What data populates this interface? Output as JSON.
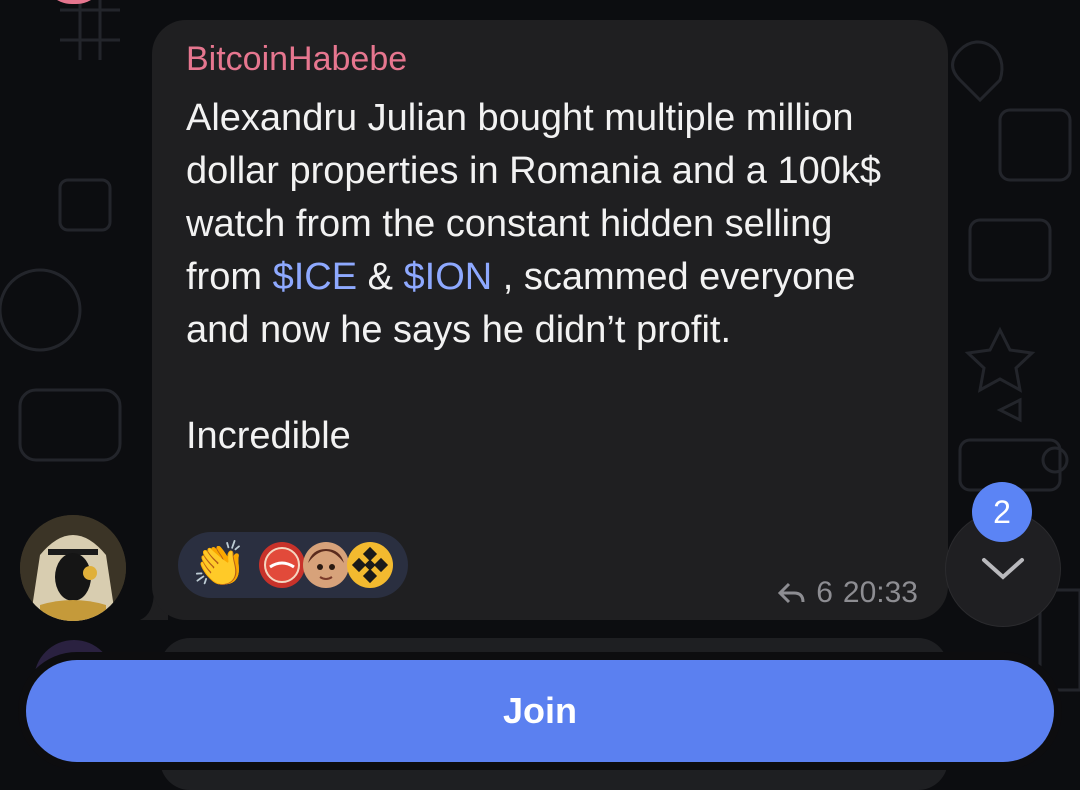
{
  "message": {
    "sender": "BitcoinHabebe",
    "text_before_ice": "Alexandru Julian bought multiple million dollar properties in Romania and a 100k$ watch from the constant hidden selling from ",
    "mention_ice": "$ICE",
    "text_between": " & ",
    "mention_ion": "$ION",
    "text_after_ion": " , scammed everyone and now he says he didn’t profit.",
    "text_final": "Incredible",
    "reactions": [
      {
        "emoji": "clapping-hands",
        "glyph": "👏"
      },
      {
        "emoji": "dude-bottle-cap"
      },
      {
        "emoji": "cartoon-avatar"
      },
      {
        "emoji": "binance-logo"
      }
    ],
    "forward_count": "6",
    "time": "20:33"
  },
  "scroll_down": {
    "unread_count": "2"
  },
  "join_button": {
    "label": "Join"
  },
  "colors": {
    "sender_name": "#e6768f",
    "mention": "#8ea9ff",
    "join_button": "#5b80f0",
    "badge": "#5b84f5"
  }
}
